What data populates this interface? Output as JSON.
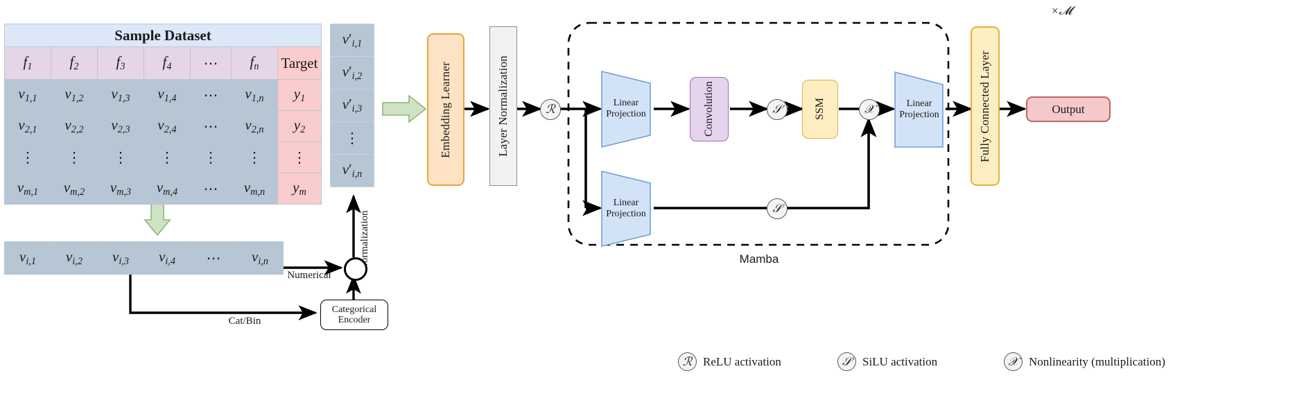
{
  "dataset": {
    "title": "Sample Dataset",
    "feature_headers": [
      "f1",
      "f2",
      "f3",
      "f4",
      "⋯",
      "fn"
    ],
    "target_header": "Target",
    "rows": [
      {
        "cells": [
          "v1,1",
          "v1,2",
          "v1,3",
          "v1,4",
          "⋯",
          "v1,n"
        ],
        "target": "y1"
      },
      {
        "cells": [
          "v2,1",
          "v2,2",
          "v2,3",
          "v2,4",
          "⋯",
          "v2,n"
        ],
        "target": "y2"
      },
      {
        "cells": [
          "⋮",
          "⋮",
          "⋮",
          "⋮",
          "⋮",
          "⋮"
        ],
        "target": "⋮"
      },
      {
        "cells": [
          "vm,1",
          "vm,2",
          "vm,3",
          "vm,4",
          "⋯",
          "vm,n"
        ],
        "target": "ym"
      }
    ]
  },
  "row_vector": {
    "cells": [
      "vi,1",
      "vi,2",
      "vi,3",
      "vi,4",
      "⋯",
      "vi,n"
    ]
  },
  "vprime_vector": {
    "cells": [
      "v'i,1",
      "v'i,2",
      "v'i,3",
      "⋮",
      "v'i,n"
    ]
  },
  "edges": {
    "numerical": "Numerical",
    "cat_bin": "Cat/Bin",
    "normalization": "Normalization"
  },
  "blocks": {
    "categorical_encoder": "Categorical\nEncoder",
    "categorical_encoder_line1": "Categorical",
    "categorical_encoder_line2": "Encoder",
    "embedding_learner": "Embedding Learner",
    "layer_normalization": "Layer Normalization",
    "linear_projection": "Linear Projection",
    "linear_projection_l1": "Linear",
    "linear_projection_l2": "Projection",
    "convolution": "Convolution",
    "ssm": "SSM",
    "fully_connected_layer": "Fully Connected Layer",
    "output": "Output"
  },
  "mamba": {
    "label": "Mamba",
    "repeat": "×𝓜",
    "repeat_fallback": "×M"
  },
  "symbols": {
    "relu": "ℛ",
    "silu": "𝒮",
    "nonlinearity": "𝒳"
  },
  "legend": [
    {
      "symbol": "ℛ",
      "text": "ReLU activation"
    },
    {
      "symbol": "𝒮",
      "text": "SiLU activation"
    },
    {
      "symbol": "𝒳",
      "text": "Nonlinearity (multiplication)"
    }
  ],
  "colors": {
    "header_blue": "#dce7f7",
    "header_pink": "#e6d5e6",
    "cell_blue_gray": "#b7c6d4",
    "target_pink": "#f9cdcd",
    "green_arrow_fill": "#cfe3c4",
    "green_arrow_stroke": "#8fb47a",
    "embedding_fill": "#fde3c4",
    "embedding_stroke": "#e8a33d",
    "layernorm_fill": "#f2f2f2",
    "layernorm_stroke": "#8c8c8c",
    "linear_fill": "#d3e3f7",
    "linear_stroke": "#6f9ed8",
    "conv_fill": "#e5d4ec",
    "conv_stroke": "#9a6fb0",
    "ssm_fill": "#fdeec2",
    "ssm_stroke": "#e0b03a",
    "fc_fill": "#fdeec2",
    "fc_stroke": "#e0b03a",
    "output_fill": "#f4c9c9",
    "output_stroke": "#c06464",
    "arrow_black": "#000000"
  }
}
